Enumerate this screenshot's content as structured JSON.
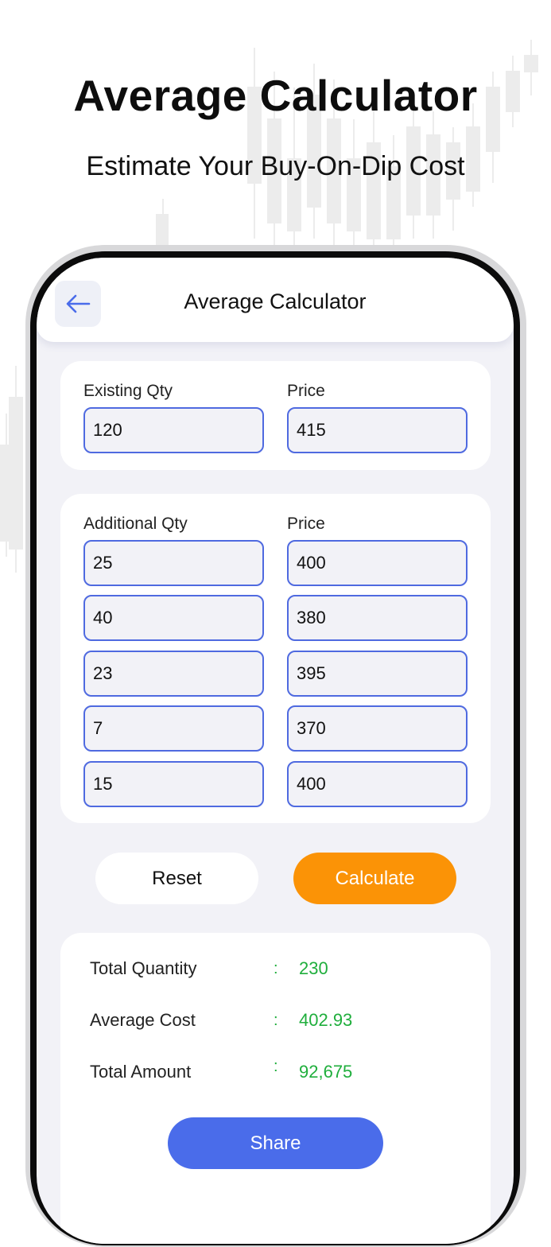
{
  "hero": {
    "title": "Average Calculator",
    "subtitle": "Estimate Your Buy-On-Dip Cost"
  },
  "header": {
    "title": "Average Calculator",
    "back_icon": "arrow-left-icon"
  },
  "existing": {
    "qty_label": "Existing Qty",
    "price_label": "Price",
    "qty": "120",
    "price": "415"
  },
  "additional": {
    "qty_label": "Additional Qty",
    "price_label": "Price",
    "rows": [
      {
        "qty": "25",
        "price": "400"
      },
      {
        "qty": "40",
        "price": "380"
      },
      {
        "qty": "23",
        "price": "395"
      },
      {
        "qty": "7",
        "price": "370"
      },
      {
        "qty": "15",
        "price": "400"
      }
    ]
  },
  "actions": {
    "reset_label": "Reset",
    "calculate_label": "Calculate"
  },
  "results": {
    "colon": ":",
    "total_quantity_label": "Total Quantity",
    "total_quantity": "230",
    "average_cost_label": "Average Cost",
    "average_cost": "402.93",
    "total_amount_label": "Total Amount",
    "total_amount": "92,675",
    "share_label": "Share"
  },
  "colors": {
    "accent_blue": "#4a6cea",
    "calculate_orange": "#fb9306",
    "result_green": "#1fae3c",
    "screen_bg": "#f2f2f7"
  }
}
